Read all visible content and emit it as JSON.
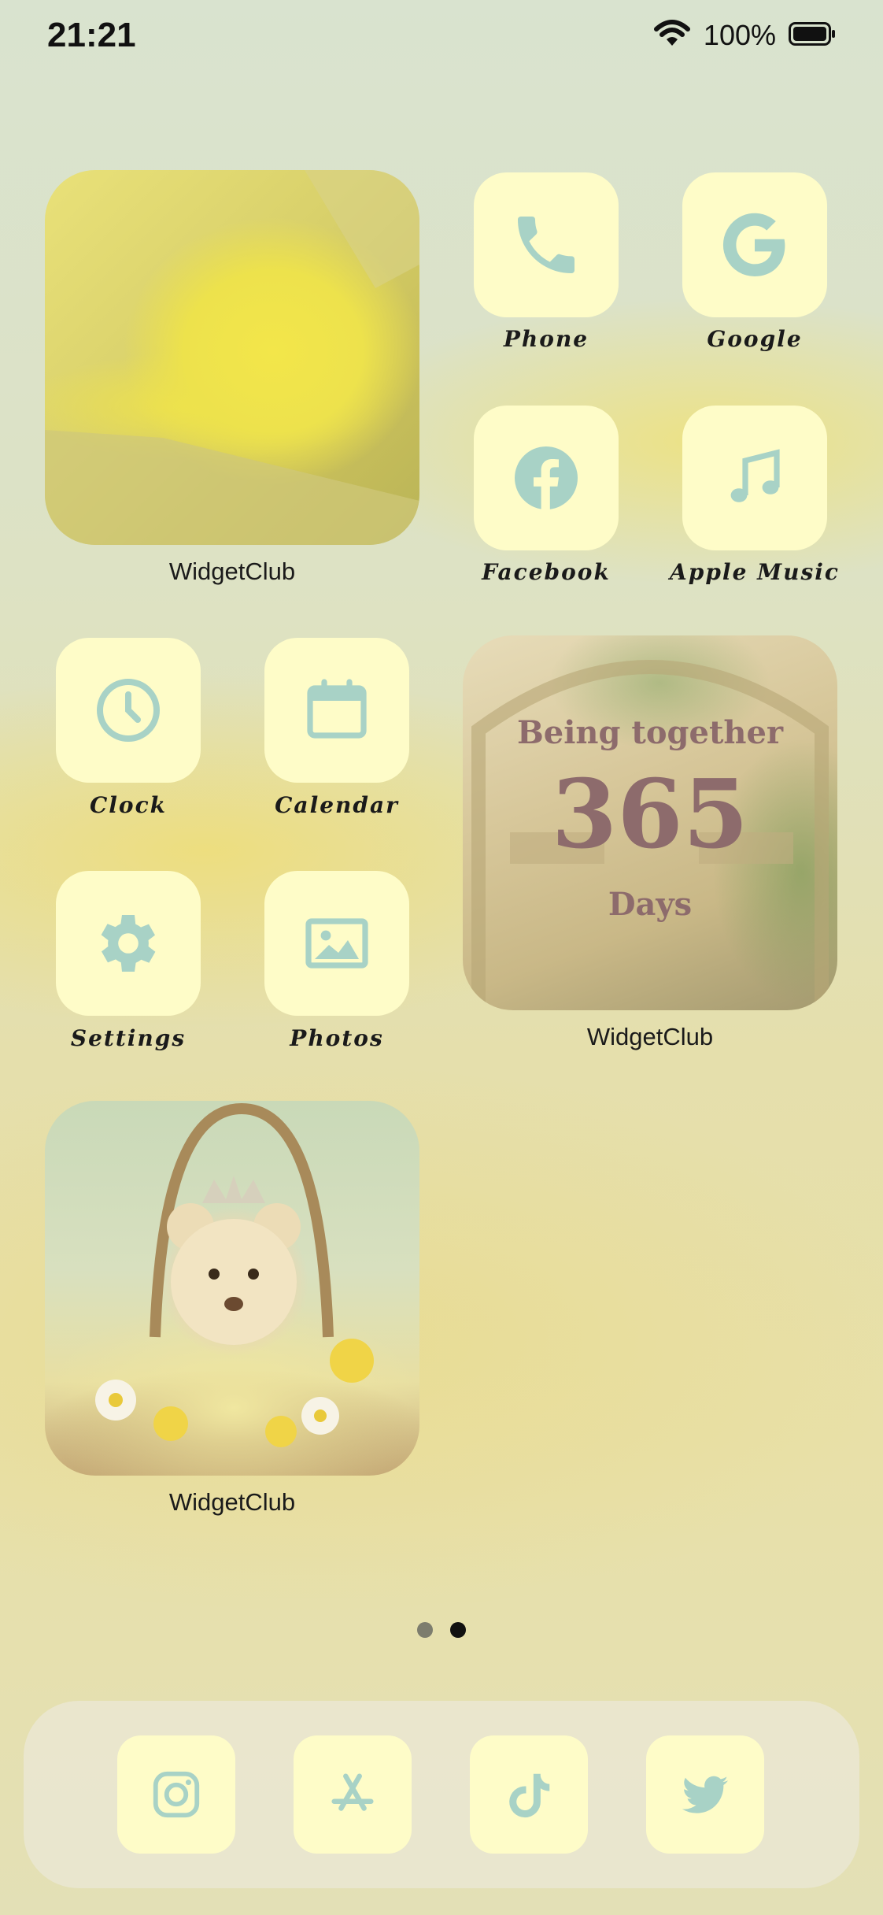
{
  "status_bar": {
    "time": "21:21",
    "battery_percent": "100%"
  },
  "colors": {
    "tile": "#fefcc8",
    "glyph": "#a8d2c6",
    "label": "#1a1a1a"
  },
  "widgets": {
    "cat": {
      "label": "WidgetClub"
    },
    "together": {
      "line1": "Being together",
      "number": "365",
      "line2": "Days",
      "label": "WidgetClub"
    },
    "bear": {
      "label": "WidgetClub"
    }
  },
  "apps": {
    "phone": {
      "label": "Phone",
      "icon": "phone-icon"
    },
    "google": {
      "label": "Google",
      "icon": "google-icon"
    },
    "facebook": {
      "label": "Facebook",
      "icon": "facebook-icon"
    },
    "apple_music": {
      "label": "Apple Music",
      "icon": "music-note-icon"
    },
    "clock": {
      "label": "Clock",
      "icon": "clock-icon"
    },
    "calendar": {
      "label": "Calendar",
      "icon": "calendar-icon"
    },
    "settings": {
      "label": "Settings",
      "icon": "gear-icon"
    },
    "photos": {
      "label": "Photos",
      "icon": "photo-icon"
    }
  },
  "page_indicator": {
    "pages": 2,
    "current": 2
  },
  "dock": [
    {
      "icon": "instagram-icon"
    },
    {
      "icon": "app-store-icon"
    },
    {
      "icon": "tiktok-icon"
    },
    {
      "icon": "twitter-icon"
    }
  ]
}
